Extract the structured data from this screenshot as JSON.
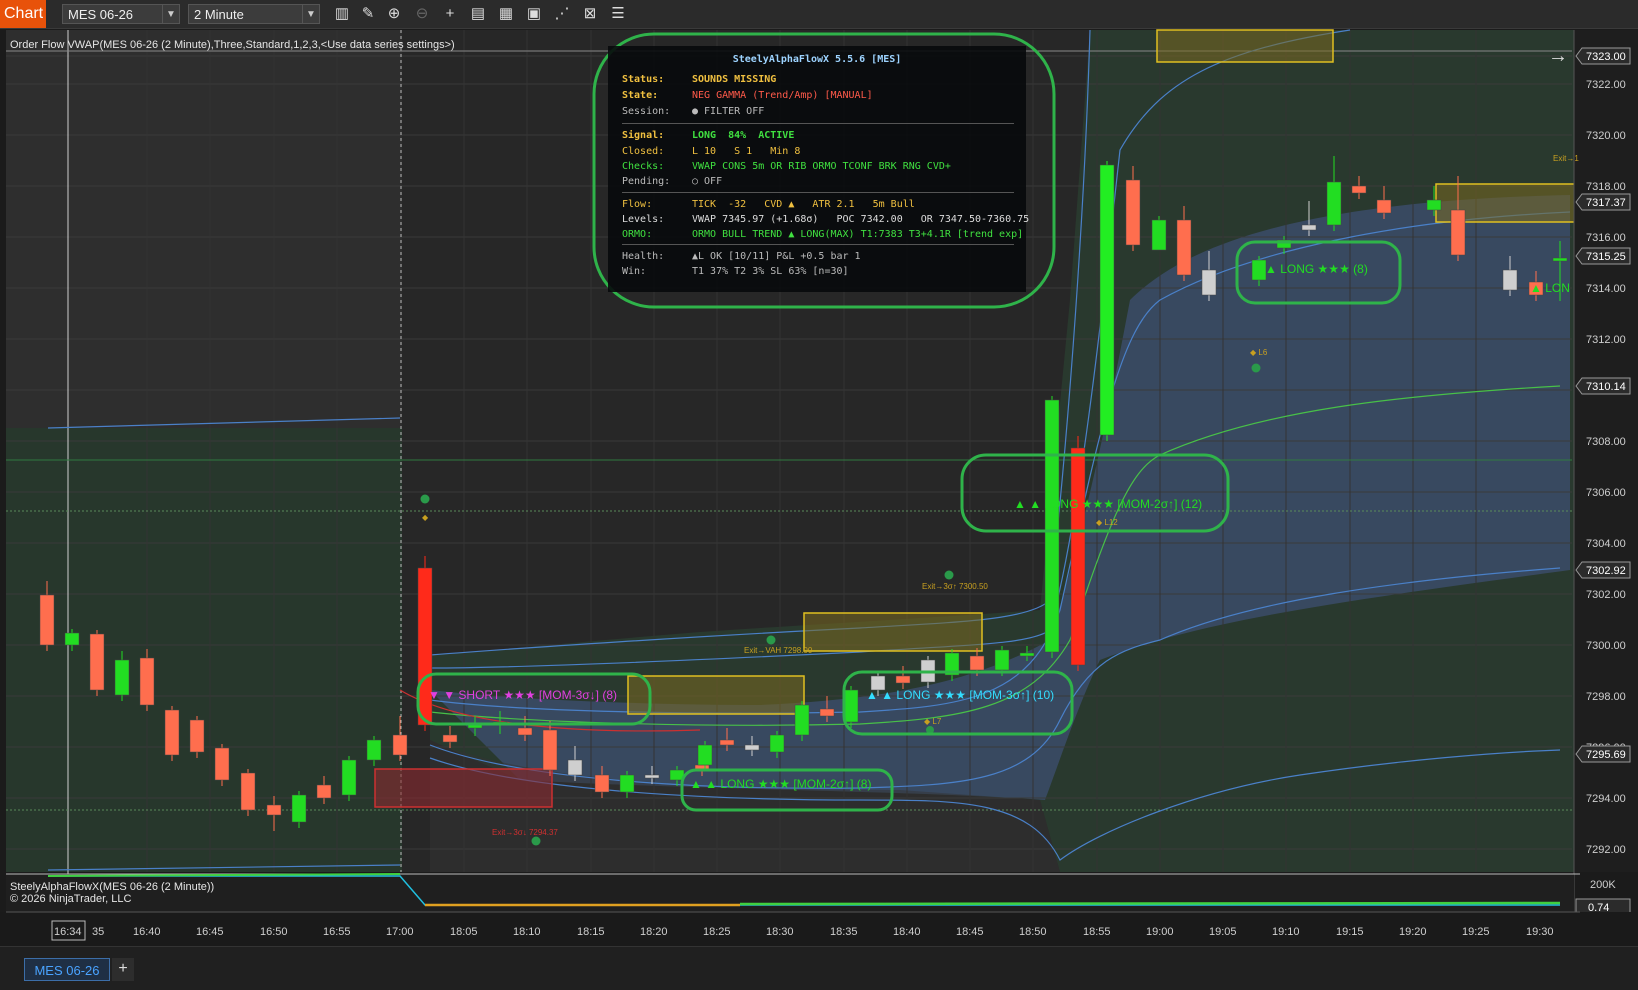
{
  "toolbar": {
    "chart_tab": "Chart",
    "instrument": "MES 06-26",
    "timeframe": "2 Minute",
    "icons": [
      "bar-type-icon",
      "pencil-draw-icon",
      "zoom-in-icon",
      "zoom-out-icon",
      "crosshair-icon",
      "properties-icon",
      "templates-icon",
      "strategy-icon",
      "indicator-icon",
      "data-box-icon",
      "list-icon"
    ]
  },
  "indicator_label": "Order Flow VWAP(MES 06-26 (2 Minute),Three,Standard,1,2,3,<Use data series settings>)",
  "pane2": {
    "line1": "SteelyAlphaFlowX(MES 06-26 (2 Minute))",
    "line2": "© 2026 NinjaTrader, LLC"
  },
  "infobox": {
    "title": "SteelyAlphaFlowX 5.5.6  [MES]",
    "status_k": "Status:",
    "status_v": "SOUNDS MISSING",
    "state_k": "State:",
    "state_v": "NEG GAMMA (Trend/Amp) [MANUAL]",
    "session_k": "Session:",
    "session_v": "● FILTER OFF",
    "signal_k": "Signal:",
    "signal_v": "LONG  84%  ACTIVE",
    "closed_k": "Closed:",
    "closed_v": "L 10   S 1   Min 8",
    "checks_k": "Checks:",
    "checks_v": "VWAP CONS 5m OR RIB ORMO TCONF BRK RNG CVD+",
    "pending_k": "Pending:",
    "pending_v": "○ OFF",
    "flow_k": "Flow:",
    "flow_v": "TICK  -32   CVD ▲   ATR 2.1   5m Bull",
    "levels_k": "Levels:",
    "levels_v": "VWAP 7345.97 (+1.68σ)   POC 7342.00   OR 7347.50-7360.75",
    "ormo_k": "ORMO:",
    "ormo_v": "ORMO BULL TREND ▲ LONG(MAX) T1:7383 T3+4.1R [trend exp]",
    "health_k": "Health:",
    "health_v": "▲L OK [10/11] P&L +0.5 bar 1",
    "win_k": "Win:",
    "win_v": "T1 37% T2 3% SL 63% [n=30]"
  },
  "price_axis": [
    "7323.00",
    "7322.00",
    "7320.00",
    "7318.00",
    "7316.00",
    "7314.00",
    "7312.00",
    "7310.00",
    "7308.00",
    "7306.00",
    "7304.00",
    "7302.00",
    "7300.00",
    "7298.00",
    "7296.00",
    "7294.00",
    "7292.00"
  ],
  "price_markers": [
    {
      "text": "7323.00",
      "color": "#2b2b2b"
    },
    {
      "text": "7317.37",
      "color": "#2b2b2b"
    },
    {
      "text": "7315.25",
      "color": "#2b2b2b"
    },
    {
      "text": "7310.14",
      "color": "#2b2b2b"
    },
    {
      "text": "7302.92",
      "color": "#2b2b2b"
    },
    {
      "text": "7295.69",
      "color": "#2b2b2b"
    }
  ],
  "pane2_axis": {
    "top": "200K",
    "value": "0.74"
  },
  "time_axis": [
    "16:34",
    "16:35",
    "16:40",
    "16:45",
    "16:50",
    "16:55",
    "17:00",
    "18:05",
    "18:10",
    "18:15",
    "18:20",
    "18:25",
    "18:30",
    "18:35",
    "18:40",
    "18:45",
    "18:50",
    "18:55",
    "19:00",
    "19:05",
    "19:10",
    "19:15",
    "19:20",
    "19:25",
    "19:30"
  ],
  "signals": [
    {
      "text": "▼ ▼ SHORT ★★★ [MOM-3σ↓] (8)",
      "color": "#e040e0"
    },
    {
      "text": "▲ ▲ LONG ★★★ [MOM-2σ↑] (8)",
      "color": "#22dd22"
    },
    {
      "text": "▲ ▲ LONG ★★★ [MOM-3σ↑] (10)",
      "color": "#33ddff"
    },
    {
      "text": "▲ ▲ LONG ★★★ [MOM-2σ↑] (12)",
      "color": "#22dd22"
    },
    {
      "text": "▲ LONG ★★★ (8)",
      "color": "#22dd22"
    },
    {
      "text": "▲ LON",
      "color": "#22dd22"
    }
  ],
  "small_labels": [
    {
      "text": "Exit→VAH 7298.00",
      "color": "#c8a020"
    },
    {
      "text": "Exit→3σ↑ 7300.50",
      "color": "#c8a020"
    },
    {
      "text": "Exit→3σ↓ 7294.37",
      "color": "#d03030"
    },
    {
      "text": "Exit→1",
      "color": "#c8a020"
    },
    {
      "text": "◆ L6",
      "color": "#c8a020"
    },
    {
      "text": "◆ L7",
      "color": "#c8a020"
    },
    {
      "text": "◆ L12",
      "color": "#c8a020"
    },
    {
      "text": "◆",
      "color": "#c8a020"
    }
  ],
  "instrument_tab": "MES 06-26",
  "add_tab": "+"
}
